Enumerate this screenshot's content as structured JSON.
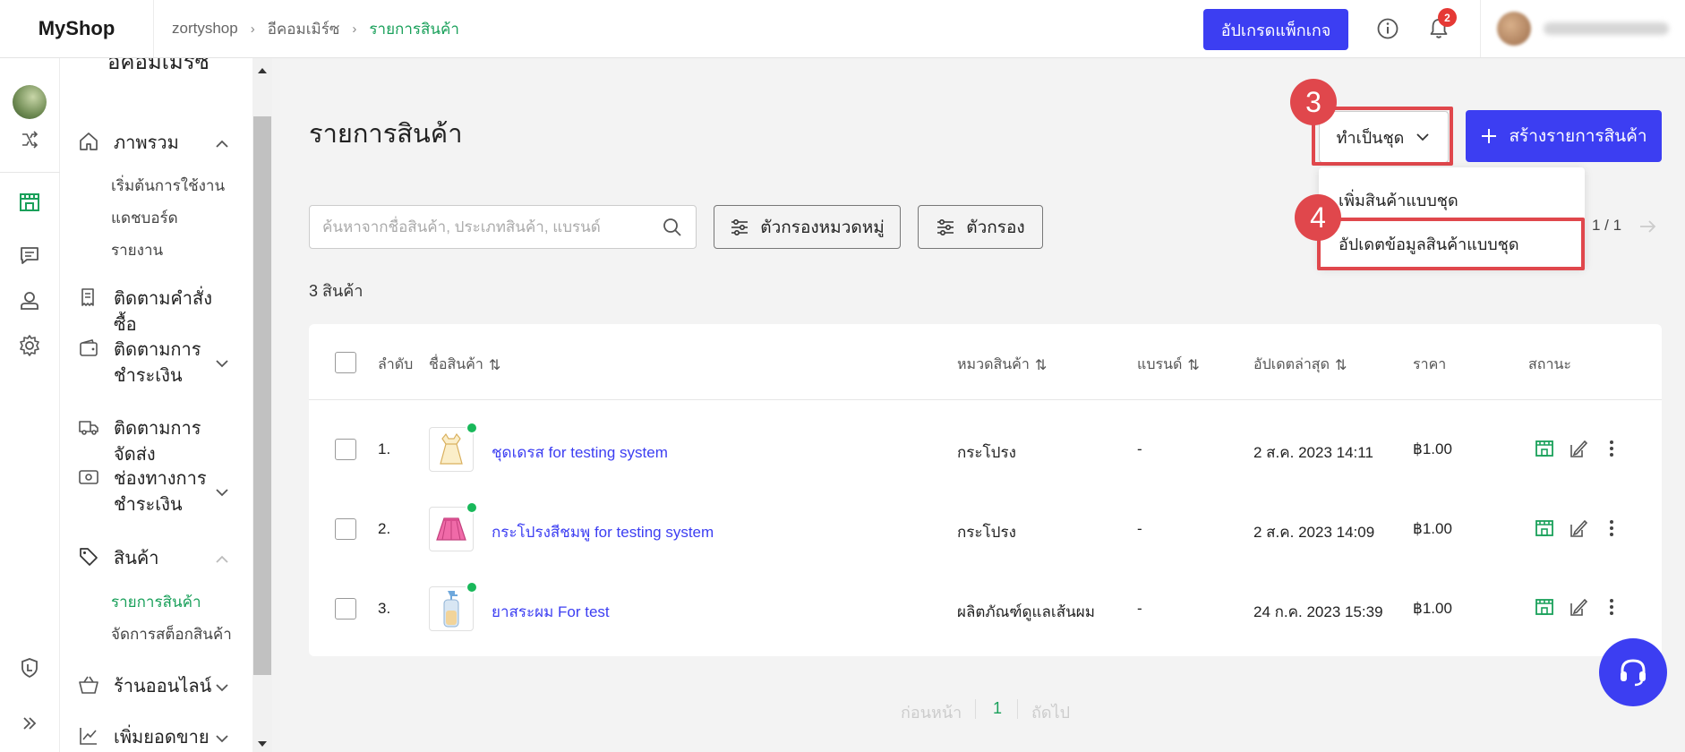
{
  "app": {
    "logo": "MyShop"
  },
  "breadcrumb": {
    "items": [
      "zortyshop",
      "อีคอมเมิร์ซ"
    ],
    "current": "รายการสินค้า"
  },
  "header": {
    "upgrade_label": "อัปเกรดแพ็กเกจ",
    "notification_count": "2"
  },
  "sidebar": {
    "section_title": "อีคอมเมิร์ซ",
    "items": [
      {
        "label": "ภาพรวม",
        "icon": "home-icon",
        "expanded": true
      },
      {
        "label": "ติดตามคำสั่งซื้อ",
        "icon": "receipt-icon"
      },
      {
        "label": "ติดตามการชำระเงิน",
        "icon": "wallet-icon",
        "expanded": false
      },
      {
        "label": "ติดตามการจัดส่ง",
        "icon": "truck-icon"
      },
      {
        "label": "ช่องทางการชำระเงิน",
        "icon": "payment-icon",
        "expanded": false
      },
      {
        "label": "สินค้า",
        "icon": "tag-icon",
        "expanded": true
      },
      {
        "label": "ร้านออนไลน์",
        "icon": "basket-icon",
        "expanded": false
      },
      {
        "label": "เพิ่มยอดขาย",
        "icon": "chart-icon",
        "expanded": false
      }
    ],
    "overview_sub": [
      "เริ่มต้นการใช้งาน",
      "แดชบอร์ด",
      "รายงาน"
    ],
    "product_sub": [
      "รายการสินค้า",
      "จัดการสต็อกสินค้า"
    ],
    "active_sub": "รายการสินค้า"
  },
  "main": {
    "title": "รายการสินค้า",
    "bulk_button": "ทำเป็นชุด",
    "create_button": "สร้างรายการสินค้า",
    "bulk_menu": [
      "เพิ่มสินค้าแบบชุด",
      "อัปเดตข้อมูลสินค้าแบบชุด"
    ],
    "steps": [
      "3",
      "4"
    ],
    "search_placeholder": "ค้นหาจากชื่อสินค้า, ประเภทสินค้า, แบรนด์",
    "category_filter": "ตัวกรองหมวดหมู่",
    "filter": "ตัวกรอง",
    "page_indicator": "1 / 1",
    "product_count": "3 สินค้า"
  },
  "table": {
    "columns": [
      "ลำดับ",
      "ชื่อสินค้า",
      "หมวดสินค้า",
      "แบรนด์",
      "อัปเดตล่าสุด",
      "ราคา",
      "สถานะ"
    ],
    "rows": [
      {
        "index": "1.",
        "name": "ชุดเดรส for testing system",
        "category": "กระโปรง",
        "brand": "-",
        "updated": "2 ส.ค. 2023 14:11",
        "price": "฿1.00",
        "image": "dress"
      },
      {
        "index": "2.",
        "name": "กระโปรงสีชมพู for testing system",
        "category": "กระโปรง",
        "brand": "-",
        "updated": "2 ส.ค. 2023 14:09",
        "price": "฿1.00",
        "image": "skirt"
      },
      {
        "index": "3.",
        "name": "ยาสระผม For test",
        "category": "ผลิตภัณฑ์ดูแลเส้นผม",
        "brand": "-",
        "updated": "24 ก.ค. 2023 15:39",
        "price": "฿1.00",
        "image": "shampoo"
      }
    ]
  },
  "pager": {
    "prev": "ก่อนหน้า",
    "current": "1",
    "next": "ถัดไป"
  },
  "colors": {
    "accent": "#3c3ef2",
    "green": "#19a05a",
    "highlight": "#e0474c"
  }
}
